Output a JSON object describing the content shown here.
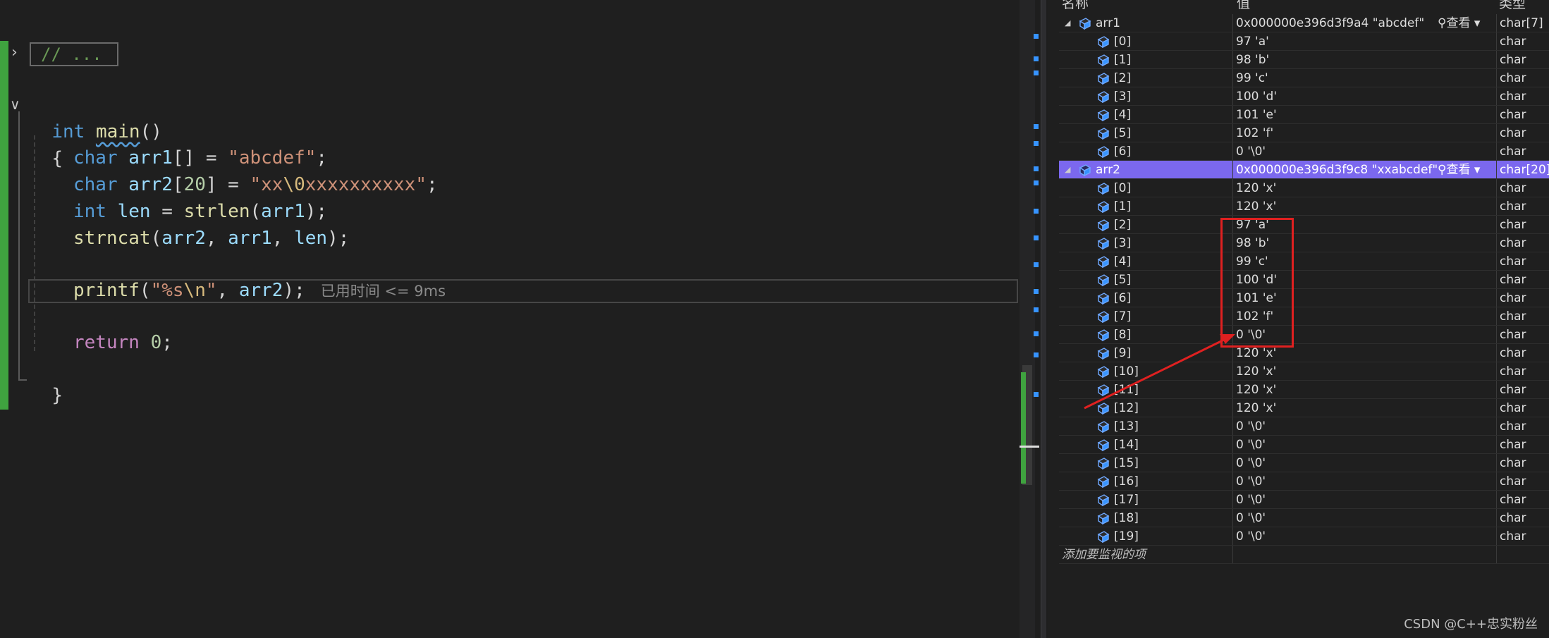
{
  "editor": {
    "collapsed_text": "// ...",
    "lines": {
      "main_type": "int",
      "main_name": "main",
      "main_parens": "()",
      "open_brace": "{",
      "close_brace": "}",
      "l1": {
        "kw": "char",
        "var": "arr1",
        "rest1": "[] = ",
        "str": "\"abcdef\"",
        "end": ";"
      },
      "l2": {
        "kw": "char",
        "var": "arr2",
        "rest1": "[",
        "num": "20",
        "rest2": "] = ",
        "str_a": "\"xx",
        "esc": "\\0",
        "str_b": "xxxxxxxxxx\"",
        "end": ";"
      },
      "l3": {
        "kw": "int",
        "var": "len",
        "rest1": " = ",
        "fn": "strlen",
        "p1": "(",
        "arg": "arr1",
        "p2": ");"
      },
      "l4": {
        "fn": "strncat",
        "p1": "(",
        "a1": "arr2",
        "c1": ", ",
        "a2": "arr1",
        "c2": ", ",
        "a3": "len",
        "p2": ");"
      },
      "l5": {
        "fn": "printf",
        "p1": "(",
        "str_a": "\"%s",
        "esc": "\\n",
        "str_b": "\"",
        "c1": ", ",
        "a1": "arr2",
        "p2": ");"
      },
      "l6": {
        "kw": "return",
        "num": "0",
        "end": ";"
      }
    },
    "perf_tip": "已用时间 <= 9ms"
  },
  "watch": {
    "headers": {
      "name": "名称",
      "value": "值",
      "type": "类型"
    },
    "view_label": "查看",
    "add_watch_placeholder": "添加要监视的项",
    "arr1": {
      "name": "arr1",
      "value": "0x000000e396d3f9a4 \"abcdef\"",
      "type": "char[7]",
      "children": [
        {
          "name": "[0]",
          "value": "97 'a'",
          "type": "char"
        },
        {
          "name": "[1]",
          "value": "98 'b'",
          "type": "char"
        },
        {
          "name": "[2]",
          "value": "99 'c'",
          "type": "char"
        },
        {
          "name": "[3]",
          "value": "100 'd'",
          "type": "char"
        },
        {
          "name": "[4]",
          "value": "101 'e'",
          "type": "char"
        },
        {
          "name": "[5]",
          "value": "102 'f'",
          "type": "char"
        },
        {
          "name": "[6]",
          "value": "0 '\\0'",
          "type": "char"
        }
      ]
    },
    "arr2": {
      "name": "arr2",
      "value": "0x000000e396d3f9c8 \"xxabcdef\"",
      "type": "char[20]",
      "children": [
        {
          "name": "[0]",
          "value": "120 'x'",
          "type": "char"
        },
        {
          "name": "[1]",
          "value": "120 'x'",
          "type": "char"
        },
        {
          "name": "[2]",
          "value": "97 'a'",
          "type": "char"
        },
        {
          "name": "[3]",
          "value": "98 'b'",
          "type": "char"
        },
        {
          "name": "[4]",
          "value": "99 'c'",
          "type": "char"
        },
        {
          "name": "[5]",
          "value": "100 'd'",
          "type": "char"
        },
        {
          "name": "[6]",
          "value": "101 'e'",
          "type": "char"
        },
        {
          "name": "[7]",
          "value": "102 'f'",
          "type": "char"
        },
        {
          "name": "[8]",
          "value": "0 '\\0'",
          "type": "char"
        },
        {
          "name": "[9]",
          "value": "120 'x'",
          "type": "char"
        },
        {
          "name": "[10]",
          "value": "120 'x'",
          "type": "char"
        },
        {
          "name": "[11]",
          "value": "120 'x'",
          "type": "char"
        },
        {
          "name": "[12]",
          "value": "120 'x'",
          "type": "char"
        },
        {
          "name": "[13]",
          "value": "0 '\\0'",
          "type": "char"
        },
        {
          "name": "[14]",
          "value": "0 '\\0'",
          "type": "char"
        },
        {
          "name": "[15]",
          "value": "0 '\\0'",
          "type": "char"
        },
        {
          "name": "[16]",
          "value": "0 '\\0'",
          "type": "char"
        },
        {
          "name": "[17]",
          "value": "0 '\\0'",
          "type": "char"
        },
        {
          "name": "[18]",
          "value": "0 '\\0'",
          "type": "char"
        },
        {
          "name": "[19]",
          "value": "0 '\\0'",
          "type": "char"
        }
      ]
    }
  },
  "colors": {
    "selected_row": "#7b68ee",
    "annotation": "#e02020",
    "change_bar": "#3fa33f"
  },
  "icons": {
    "variable": "variable-cube-icon",
    "search": "magnifier-icon",
    "expand": "triangle-expanded-icon",
    "dropdown": "dropdown-arrow-icon"
  },
  "watermark": "CSDN @C++忠实粉丝"
}
